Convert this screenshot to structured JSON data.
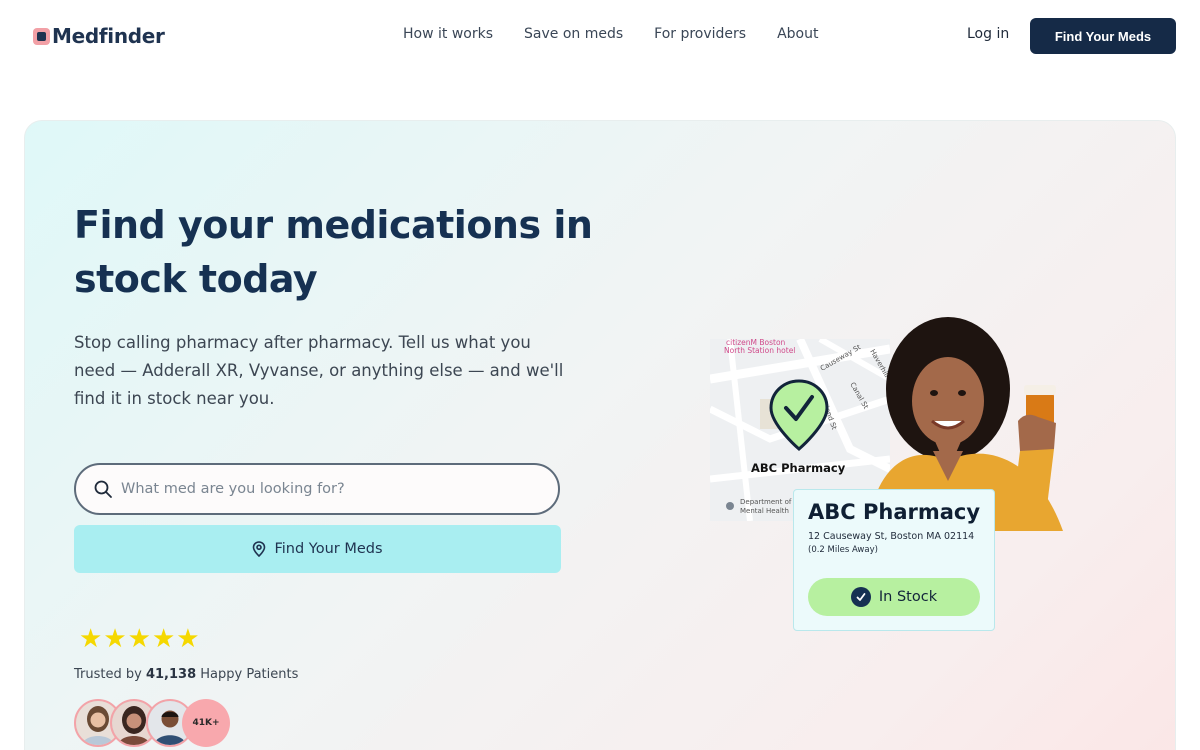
{
  "brand": {
    "name": "Medfinder"
  },
  "nav": {
    "links": [
      "How it works",
      "Save on meds",
      "For providers",
      "About"
    ],
    "login": "Log in",
    "cta": "Find Your Meds"
  },
  "hero": {
    "headline": "Find your medications in stock today",
    "subtext": "Stop calling pharmacy after pharmacy. Tell us what you need — Adderall XR, Vyvanse, or anything else — and we'll find it in stock near you.",
    "search_placeholder": "What med are you looking for?",
    "find_button": "Find Your Meds",
    "rating": {
      "stars": 5
    },
    "trusted_prefix": "Trusted by",
    "trusted_count": "41,138",
    "trusted_suffix": "Happy Patients",
    "avatar_count": "41K+"
  },
  "illustration": {
    "map_label": "ABC Pharmacy",
    "map_streets": [
      "citizenM Boston",
      "North Station hotel",
      "Causeway St",
      "Canal St",
      "Haverhill",
      "Friend St",
      "Department of",
      "Mental Health"
    ],
    "card": {
      "title": "ABC Pharmacy",
      "address": "12 Causeway St, Boston MA 02114",
      "distance": "(0.2 Miles Away)",
      "status": "In Stock"
    }
  },
  "colors": {
    "navy": "#152a47",
    "cyan_button": "#a9eef1",
    "instock_green": "#b7f0a0",
    "star": "#f5d800",
    "avatar_pink": "#f8a8ad"
  }
}
